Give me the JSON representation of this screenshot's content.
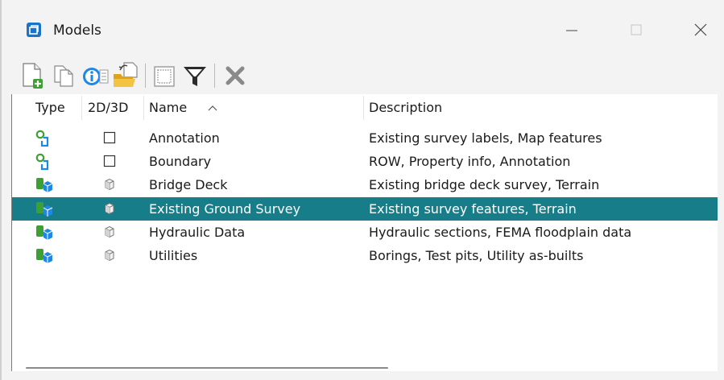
{
  "window": {
    "title": "Models"
  },
  "toolbar": {
    "buttons": [
      {
        "name": "create-model-icon"
      },
      {
        "name": "copy-model-icon"
      },
      {
        "name": "model-properties-icon"
      },
      {
        "name": "import-model-icon"
      },
      {
        "name": "select-models-icon"
      },
      {
        "name": "filter-icon"
      },
      {
        "name": "delete-model-icon"
      }
    ]
  },
  "list": {
    "headers": {
      "type": "Type",
      "dim": "2D/3D",
      "name": "Name",
      "description": "Description"
    },
    "rows": [
      {
        "type_icon": "2d-model-icon",
        "dim_icon": "2d-box-icon",
        "name": "Annotation",
        "description": "Existing survey labels, Map features",
        "selected": false
      },
      {
        "type_icon": "2d-model-icon",
        "dim_icon": "2d-box-icon",
        "name": "Boundary",
        "description": "ROW, Property info, Annotation",
        "selected": false
      },
      {
        "type_icon": "3d-model-icon",
        "dim_icon": "3d-cube-icon",
        "name": "Bridge Deck",
        "description": "Existing bridge deck survey, Terrain",
        "selected": false
      },
      {
        "type_icon": "3d-model-icon",
        "dim_icon": "3d-cube-icon",
        "name": "Existing Ground Survey",
        "description": "Existing survey features, Terrain",
        "selected": true
      },
      {
        "type_icon": "3d-model-icon",
        "dim_icon": "3d-cube-icon",
        "name": "Hydraulic Data",
        "description": "Hydraulic sections, FEMA floodplain data",
        "selected": false
      },
      {
        "type_icon": "3d-model-icon",
        "dim_icon": "3d-cube-icon",
        "name": "Utilities",
        "description": "Borings, Test pits, Utility as-builts",
        "selected": false
      }
    ]
  },
  "colors": {
    "selection": "#177e89",
    "title_icon": "#1a73c8",
    "green": "#3ca132",
    "blue": "#1e88e5"
  }
}
